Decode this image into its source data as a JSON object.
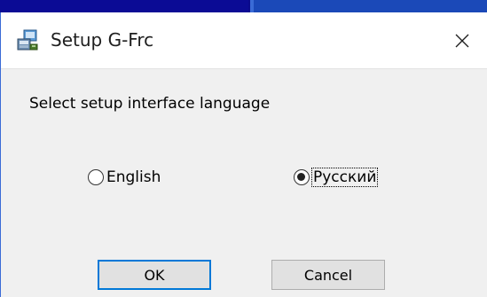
{
  "window": {
    "title": "Setup G-Frc",
    "close_glyph": "✕"
  },
  "dialog": {
    "prompt": "Select setup interface language",
    "options": [
      {
        "label": "English",
        "selected": false
      },
      {
        "label": "Русский",
        "selected": true
      }
    ],
    "ok_label": "OK",
    "cancel_label": "Cancel"
  },
  "icons": {
    "app": "setup-installer-icon",
    "close": "close-icon"
  },
  "colors": {
    "accent": "#0078d7",
    "dialog_bg": "#f0f0f0",
    "titlebar_bg": "#ffffff"
  }
}
